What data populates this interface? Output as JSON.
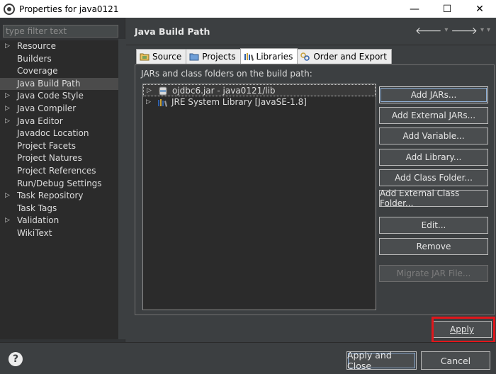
{
  "window": {
    "title": "Properties for java0121",
    "minimize_glyph": "—",
    "maximize_glyph": "☐",
    "close_glyph": "✕"
  },
  "filter": {
    "placeholder": "type filter text"
  },
  "tree": {
    "items": [
      {
        "label": "Resource",
        "expandable": true
      },
      {
        "label": "Builders",
        "expandable": false
      },
      {
        "label": "Coverage",
        "expandable": false
      },
      {
        "label": "Java Build Path",
        "expandable": false,
        "selected": true
      },
      {
        "label": "Java Code Style",
        "expandable": true
      },
      {
        "label": "Java Compiler",
        "expandable": true
      },
      {
        "label": "Java Editor",
        "expandable": true
      },
      {
        "label": "Javadoc Location",
        "expandable": false
      },
      {
        "label": "Project Facets",
        "expandable": false
      },
      {
        "label": "Project Natures",
        "expandable": false
      },
      {
        "label": "Project References",
        "expandable": false
      },
      {
        "label": "Run/Debug Settings",
        "expandable": false
      },
      {
        "label": "Task Repository",
        "expandable": true
      },
      {
        "label": "Task Tags",
        "expandable": false
      },
      {
        "label": "Validation",
        "expandable": true
      },
      {
        "label": "WikiText",
        "expandable": false
      }
    ]
  },
  "page": {
    "title": "Java Build Path",
    "nav_back": "🡐",
    "nav_forward": "🡒",
    "nav_menu": "▾"
  },
  "tabs": [
    {
      "label": "Source",
      "icon": "source-folder-icon"
    },
    {
      "label": "Projects",
      "icon": "projects-icon"
    },
    {
      "label": "Libraries",
      "icon": "libraries-icon",
      "active": true
    },
    {
      "label": "Order and Export",
      "icon": "order-export-icon"
    }
  ],
  "libraries": {
    "heading": "JARs and class folders on the build path:",
    "entries": [
      {
        "label": "ojdbc6.jar - java0121/lib",
        "icon": "jar-icon"
      },
      {
        "label": "JRE System Library [JavaSE-1.8]",
        "icon": "library-icon"
      }
    ]
  },
  "buttons": {
    "add_jars": "Add JARs...",
    "add_external_jars": "Add External JARs...",
    "add_variable": "Add Variable...",
    "add_library": "Add Library...",
    "add_class_folder": "Add Class Folder...",
    "add_external_class_folder": "Add External Class Folder...",
    "edit": "Edit...",
    "remove": "Remove",
    "migrate_jar": "Migrate JAR File..."
  },
  "apply": "Apply",
  "footer": {
    "help": "?",
    "apply_and_close": "Apply and Close",
    "cancel": "Cancel"
  },
  "colors": {
    "highlight": "#e0161b",
    "background": "#3c3f41",
    "list_background": "#2b2b2b"
  }
}
